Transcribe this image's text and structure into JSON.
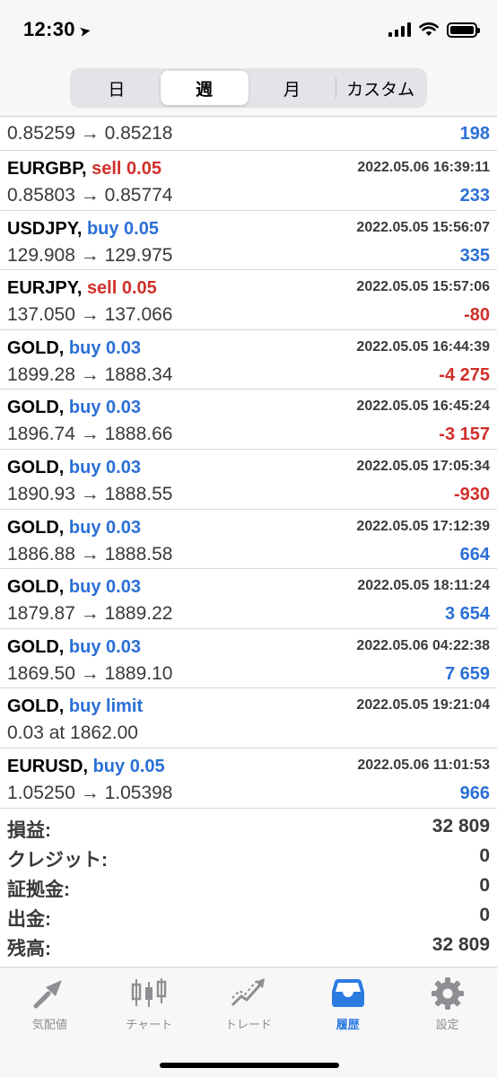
{
  "status": {
    "time": "12:30"
  },
  "segment": {
    "items": [
      "日",
      "週",
      "月",
      "カスタム"
    ],
    "active": 1
  },
  "partial_row": {
    "price": "0.85259 → 0.85218",
    "profit": "198"
  },
  "trades": [
    {
      "symbol": "EURGBP,",
      "side": "sell 0.05",
      "is_sell": true,
      "time": "2022.05.06 16:39:11",
      "price": "0.85803 → 0.85774",
      "profit": "233",
      "neg": false
    },
    {
      "symbol": "USDJPY,",
      "side": "buy 0.05",
      "is_sell": false,
      "time": "2022.05.05 15:56:07",
      "price": "129.908 → 129.975",
      "profit": "335",
      "neg": false
    },
    {
      "symbol": "EURJPY,",
      "side": "sell 0.05",
      "is_sell": true,
      "time": "2022.05.05 15:57:06",
      "price": "137.050 → 137.066",
      "profit": "-80",
      "neg": true
    },
    {
      "symbol": "GOLD,",
      "side": "buy 0.03",
      "is_sell": false,
      "time": "2022.05.05 16:44:39",
      "price": "1899.28 → 1888.34",
      "profit": "-4 275",
      "neg": true
    },
    {
      "symbol": "GOLD,",
      "side": "buy 0.03",
      "is_sell": false,
      "time": "2022.05.05 16:45:24",
      "price": "1896.74 → 1888.66",
      "profit": "-3 157",
      "neg": true
    },
    {
      "symbol": "GOLD,",
      "side": "buy 0.03",
      "is_sell": false,
      "time": "2022.05.05 17:05:34",
      "price": "1890.93 → 1888.55",
      "profit": "-930",
      "neg": true
    },
    {
      "symbol": "GOLD,",
      "side": "buy 0.03",
      "is_sell": false,
      "time": "2022.05.05 17:12:39",
      "price": "1886.88 → 1888.58",
      "profit": "664",
      "neg": false
    },
    {
      "symbol": "GOLD,",
      "side": "buy 0.03",
      "is_sell": false,
      "time": "2022.05.05 18:11:24",
      "price": "1879.87 → 1889.22",
      "profit": "3 654",
      "neg": false
    },
    {
      "symbol": "GOLD,",
      "side": "buy 0.03",
      "is_sell": false,
      "time": "2022.05.06 04:22:38",
      "price": "1869.50 → 1889.10",
      "profit": "7 659",
      "neg": false
    },
    {
      "symbol": "GOLD,",
      "side": "buy limit",
      "is_sell": false,
      "time": "2022.05.05 19:21:04",
      "price": "0.03 at 1862.00",
      "profit": "",
      "neg": false
    },
    {
      "symbol": "EURUSD,",
      "side": "buy 0.05",
      "is_sell": false,
      "time": "2022.05.06 11:01:53",
      "price": "1.05250 → 1.05398",
      "profit": "966",
      "neg": false
    }
  ],
  "summary": [
    {
      "label": "損益:",
      "value": "32 809"
    },
    {
      "label": "クレジット:",
      "value": "0"
    },
    {
      "label": "証拠金:",
      "value": "0"
    },
    {
      "label": "出金:",
      "value": "0"
    },
    {
      "label": "残高:",
      "value": "32 809"
    }
  ],
  "tabbar": {
    "items": [
      {
        "label": "気配値",
        "icon": "quotes-icon"
      },
      {
        "label": "チャート",
        "icon": "chart-icon"
      },
      {
        "label": "トレード",
        "icon": "trade-icon"
      },
      {
        "label": "履歴",
        "icon": "history-icon"
      },
      {
        "label": "設定",
        "icon": "settings-icon"
      }
    ],
    "active": 3
  },
  "colors": {
    "buy": "#2b6fd6",
    "sell": "#d0302a",
    "active_tab": "#2b7be0",
    "inactive_tab": "#8e8e93"
  }
}
